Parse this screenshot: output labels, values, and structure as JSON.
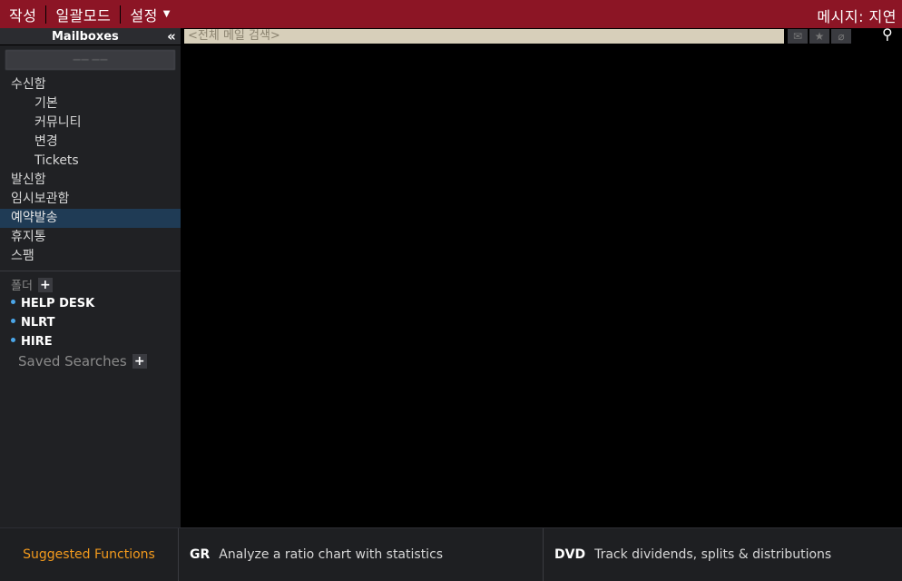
{
  "topbar": {
    "menu": [
      "작성",
      "일괄모드",
      "설정"
    ],
    "status": "메시지: 지연"
  },
  "sidebar": {
    "title": "Mailboxes",
    "collapse": "«",
    "account": "—— ——",
    "nav": [
      {
        "label": "수신함",
        "sub": false,
        "active": false
      },
      {
        "label": "기본",
        "sub": true,
        "active": false
      },
      {
        "label": "커뮤니티",
        "sub": true,
        "active": false
      },
      {
        "label": "변경",
        "sub": true,
        "active": false
      },
      {
        "label": "Tickets",
        "sub": true,
        "active": false
      },
      {
        "label": "발신함",
        "sub": false,
        "active": false
      },
      {
        "label": "임시보관함",
        "sub": false,
        "active": false
      },
      {
        "label": "예약발송",
        "sub": false,
        "active": true
      },
      {
        "label": "휴지통",
        "sub": false,
        "active": false
      },
      {
        "label": "스팸",
        "sub": false,
        "active": false
      }
    ],
    "folders_label": "폴더",
    "folders": [
      "HELP DESK",
      "NLRT",
      "HIRE"
    ],
    "saved_searches_label": "Saved Searches"
  },
  "search": {
    "placeholder": "<전체 메일 검색>"
  },
  "bottom": {
    "label": "Suggested Functions",
    "functions": [
      {
        "code": "GR",
        "text": "Analyze a ratio chart with statistics"
      },
      {
        "code": "DVD",
        "text": "Track dividends, splits & distributions"
      }
    ]
  }
}
